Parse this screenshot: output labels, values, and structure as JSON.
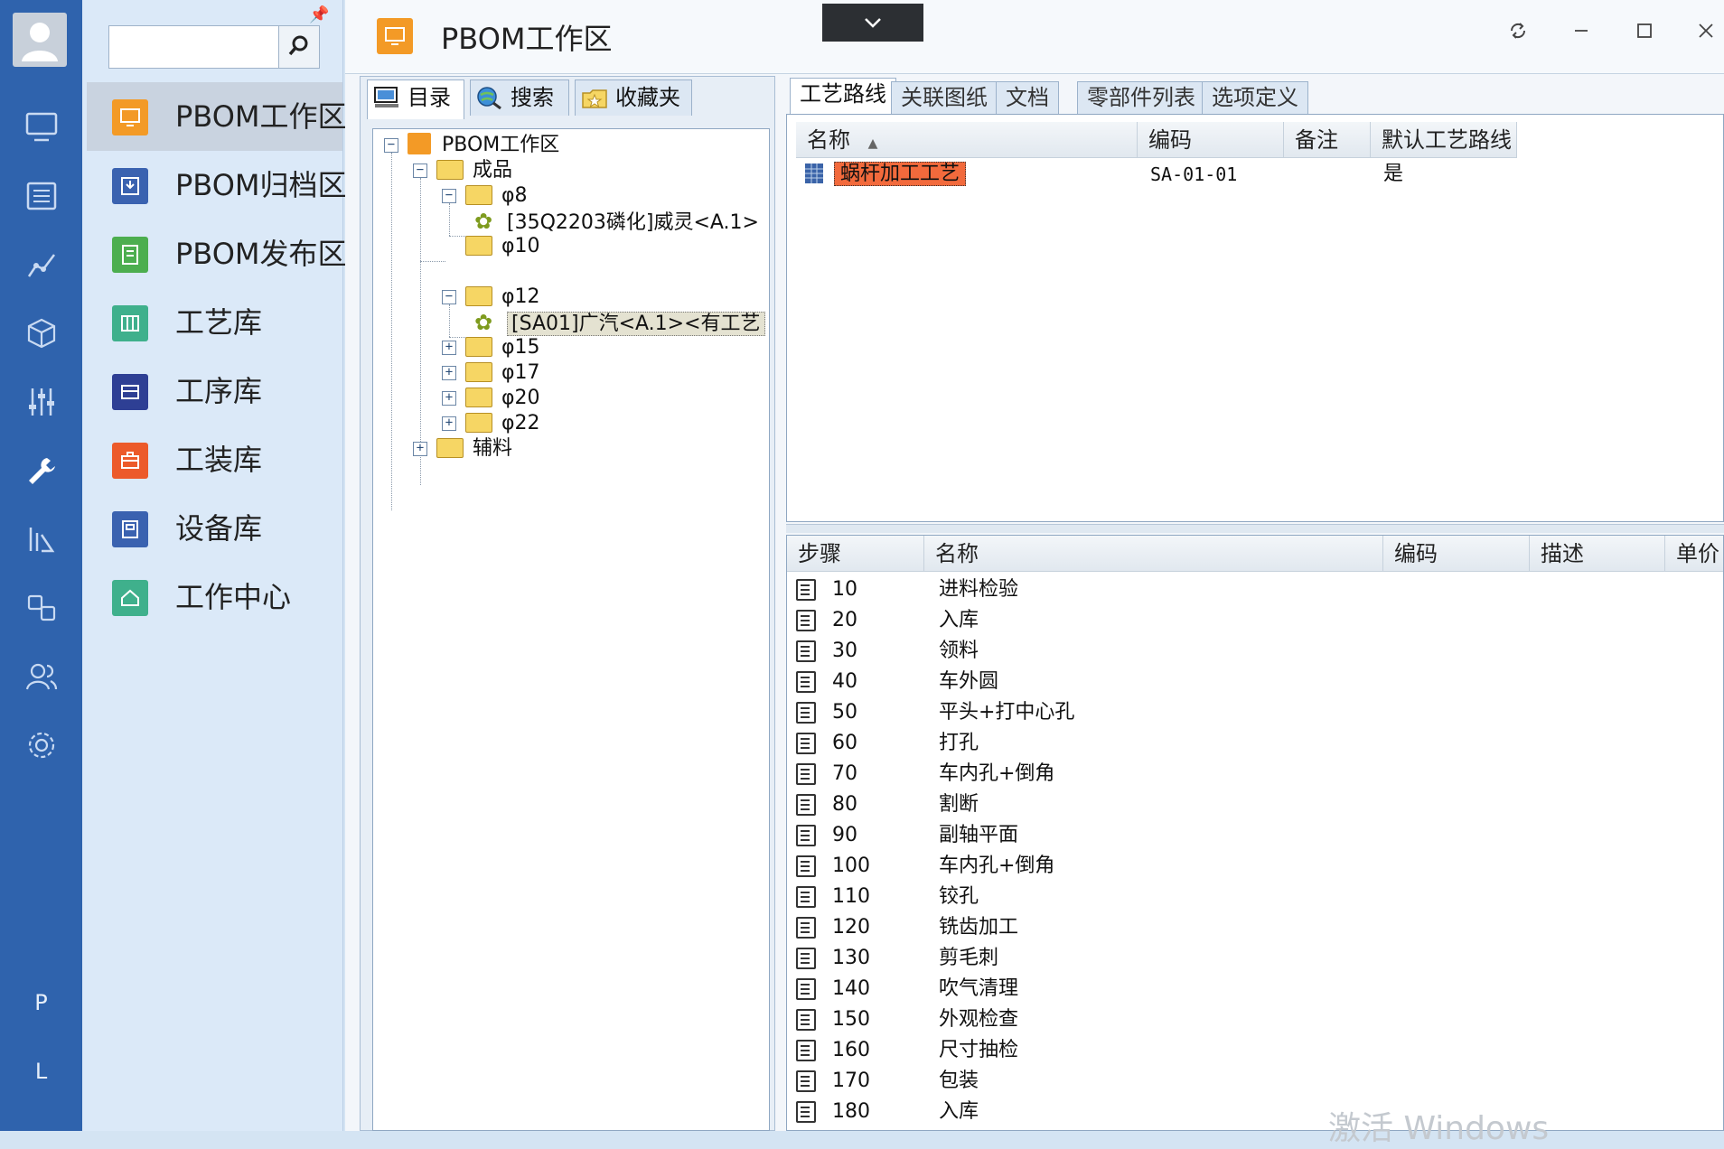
{
  "rail": {
    "bottom_letters": [
      "P",
      "L"
    ]
  },
  "menu": {
    "items": [
      {
        "label": "PBOM工作区",
        "color": "#f39a26",
        "icon": "monitor-icon"
      },
      {
        "label": "PBOM归档区",
        "color": "#3a62b0",
        "icon": "archive-icon"
      },
      {
        "label": "PBOM发布区",
        "color": "#4cae4f",
        "icon": "publish-icon"
      },
      {
        "label": "工艺库",
        "color": "#3fb08c",
        "icon": "process-library-icon"
      },
      {
        "label": "工序库",
        "color": "#2e3f94",
        "icon": "operation-library-icon"
      },
      {
        "label": "工装库",
        "color": "#ec5a2a",
        "icon": "toolbox-icon"
      },
      {
        "label": "设备库",
        "color": "#3a62b0",
        "icon": "equipment-icon"
      },
      {
        "label": "工作中心",
        "color": "#3fb08c",
        "icon": "home-icon"
      }
    ]
  },
  "window": {
    "title": "PBOM工作区"
  },
  "left_tabs": [
    "目录",
    "搜索",
    "收藏夹"
  ],
  "tree": {
    "root": "PBOM工作区",
    "nodes": [
      {
        "label": "成品"
      },
      {
        "label": "φ8"
      },
      {
        "label": "[35Q2203磷化]威灵<A.1>"
      },
      {
        "label": "φ10"
      },
      {
        "label": "φ12"
      },
      {
        "label": "[SA01]广汽<A.1><有工艺"
      },
      {
        "label": "φ15"
      },
      {
        "label": "φ17"
      },
      {
        "label": "φ20"
      },
      {
        "label": "φ22"
      },
      {
        "label": "辅料"
      }
    ]
  },
  "right_tabs": [
    "工艺路线",
    "关联图纸",
    "文档",
    "零部件列表",
    "选项定义"
  ],
  "route_grid": {
    "headers": [
      "名称",
      "编码",
      "备注",
      "默认工艺路线"
    ],
    "sort_indicator": "▲",
    "rows": [
      {
        "name": "蜗杆加工工艺",
        "code": "SA-01-01",
        "note": "",
        "default": "是"
      }
    ]
  },
  "step_grid": {
    "headers": [
      "步骤",
      "名称",
      "编码",
      "描述",
      "单价"
    ],
    "rows": [
      {
        "step": "10",
        "name": "进料检验"
      },
      {
        "step": "20",
        "name": "入库"
      },
      {
        "step": "30",
        "name": "领料"
      },
      {
        "step": "40",
        "name": "车外圆"
      },
      {
        "step": "50",
        "name": "平头+打中心孔"
      },
      {
        "step": "60",
        "name": "打孔"
      },
      {
        "step": "70",
        "name": "车内孔+倒角"
      },
      {
        "step": "80",
        "name": "割断"
      },
      {
        "step": "90",
        "name": "副轴平面"
      },
      {
        "step": "100",
        "name": "车内孔+倒角"
      },
      {
        "step": "110",
        "name": "铰孔"
      },
      {
        "step": "120",
        "name": "铣齿加工"
      },
      {
        "step": "130",
        "name": "剪毛刺"
      },
      {
        "step": "140",
        "name": "吹气清理"
      },
      {
        "step": "150",
        "name": "外观检查"
      },
      {
        "step": "160",
        "name": "尺寸抽检"
      },
      {
        "step": "170",
        "name": "包装"
      },
      {
        "step": "180",
        "name": "入库"
      }
    ]
  },
  "watermark": "激活 Windows"
}
